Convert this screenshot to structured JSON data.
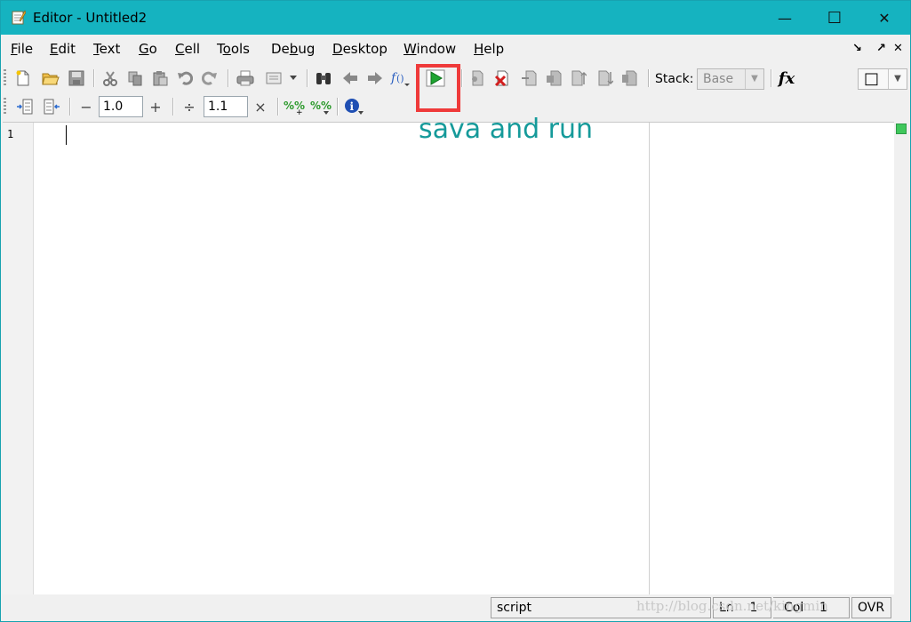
{
  "window": {
    "title": "Editor - Untitled2",
    "controls": {
      "minimize": "—",
      "maximize": "☐",
      "close": "✕"
    }
  },
  "menubar": {
    "items": [
      {
        "pre": "",
        "u": "F",
        "post": "ile"
      },
      {
        "pre": "",
        "u": "E",
        "post": "dit"
      },
      {
        "pre": "",
        "u": "T",
        "post": "ext"
      },
      {
        "pre": "",
        "u": "G",
        "post": "o"
      },
      {
        "pre": "",
        "u": "C",
        "post": "ell"
      },
      {
        "pre": "T",
        "u": "o",
        "post": "ols"
      },
      {
        "pre": "De",
        "u": "b",
        "post": "ug"
      },
      {
        "pre": "",
        "u": "D",
        "post": "esktop"
      },
      {
        "pre": "",
        "u": "W",
        "post": "indow"
      },
      {
        "pre": "",
        "u": "H",
        "post": "elp"
      }
    ],
    "right": {
      "undock": "↘",
      "dock": "↗",
      "close": "✕"
    }
  },
  "toolbar": {
    "stack_label": "Stack:",
    "stack_value": "Base",
    "fx": "fx",
    "layout_value": "□"
  },
  "cell_toolbar": {
    "decrement": "−",
    "increment_value": "1.0",
    "increment": "+",
    "divide": "÷",
    "divide_value": "1.1",
    "multiply": "×"
  },
  "editor": {
    "line_numbers": [
      "1"
    ],
    "content": ""
  },
  "statusbar": {
    "mode": "script",
    "ln_label": "Ln",
    "ln_value": "1",
    "col_label": "Col",
    "col_value": "1",
    "ovr": "OVR"
  },
  "annotation": {
    "text": "sava and run",
    "color": "#159a9a",
    "box_color": "#ef3a3a"
  },
  "watermark": {
    "text": "http://blog.csdn.net/kingmin"
  },
  "colors": {
    "titlebar": "#15b3c0",
    "run_green": "#1fa531"
  }
}
